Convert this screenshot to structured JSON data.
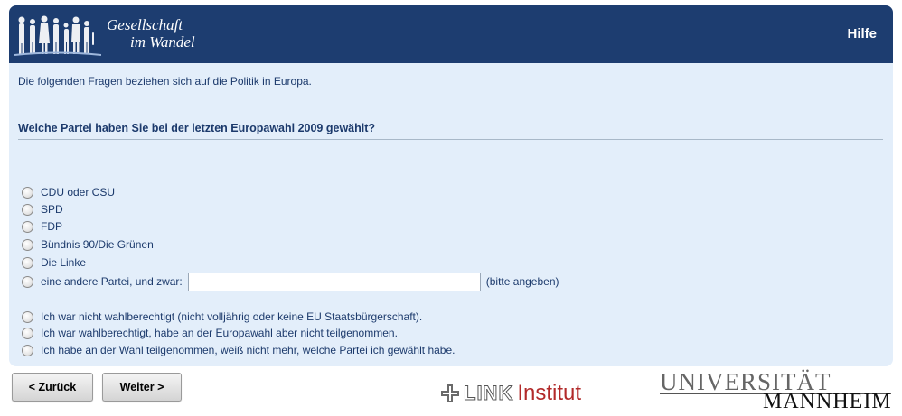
{
  "header": {
    "brand_line1": "Gesellschaft",
    "brand_line2": "im Wandel",
    "help_label": "Hilfe"
  },
  "survey": {
    "intro": "Die folgenden Fragen beziehen sich auf die Politik in Europa.",
    "question": "Welche Partei haben Sie bei der letzten Europawahl 2009 gewählt?",
    "options": [
      "CDU oder CSU",
      "SPD",
      "FDP",
      "Bündnis 90/Die Grünen",
      "Die Linke",
      "eine andere Partei, und zwar:"
    ],
    "other_value": "",
    "other_hint": "(bitte angeben)",
    "extra_options": [
      "Ich war nicht wahlberechtigt (nicht volljährig oder keine EU Staatsbürgerschaft).",
      "Ich war wahlberechtigt, habe an der Europawahl aber nicht teilgenommen.",
      "Ich habe an der Wahl teilgenommen, weiß nicht mehr, welche Partei ich gewählt habe."
    ]
  },
  "nav": {
    "back_label": "< Zurück",
    "next_label": "Weiter >"
  },
  "logos": {
    "link_word": "LINK",
    "institut_word": "Institut",
    "uni_line1": "UNIVERSITÄT",
    "uni_line2": "MANNHEIM"
  },
  "colors": {
    "header_bg": "#1d3d70",
    "panel_bg": "#e3eefa",
    "text": "#1c3a6c",
    "institut_red": "#b22a2a"
  }
}
